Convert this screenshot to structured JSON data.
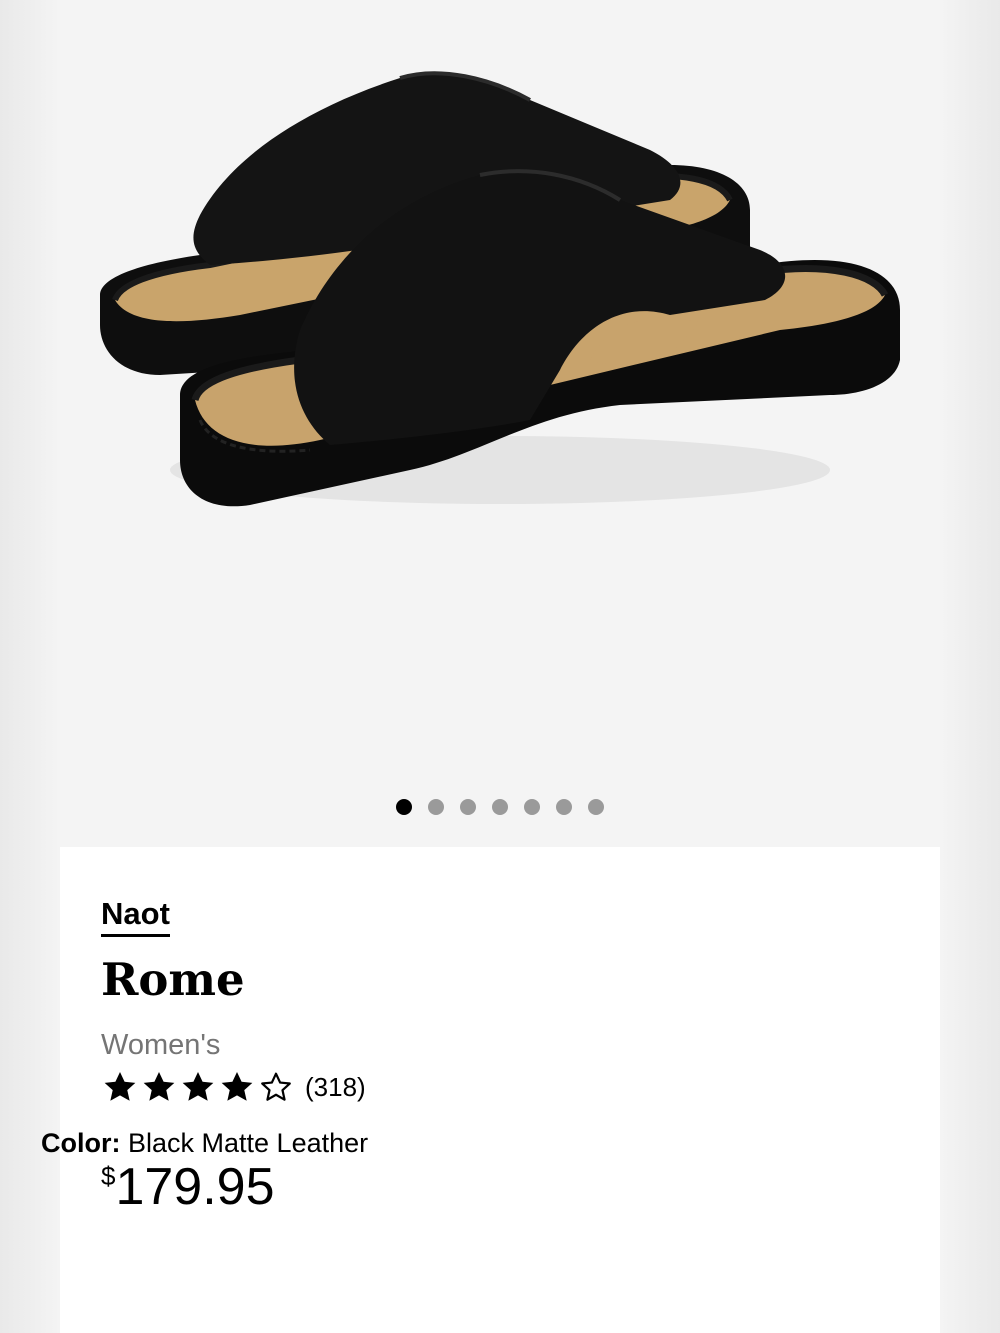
{
  "gallery": {
    "image_alt": "Naot Rome Black Matte Leather sandals",
    "dot_count": 7,
    "active_index": 0
  },
  "product": {
    "brand": "Naot",
    "name": "Rome",
    "gender": "Women's",
    "rating": 4,
    "rating_max": 5,
    "review_count": "(318)",
    "price_currency": "$",
    "price_amount": "179.95",
    "color_label": "Color:",
    "color_value": "Black Matte Leather"
  },
  "colors": {
    "text": "#000000",
    "muted": "#757575",
    "dot_inactive": "#9a9a9a",
    "dot_active": "#000000",
    "background": "#f4f4f4",
    "card": "#ffffff"
  }
}
